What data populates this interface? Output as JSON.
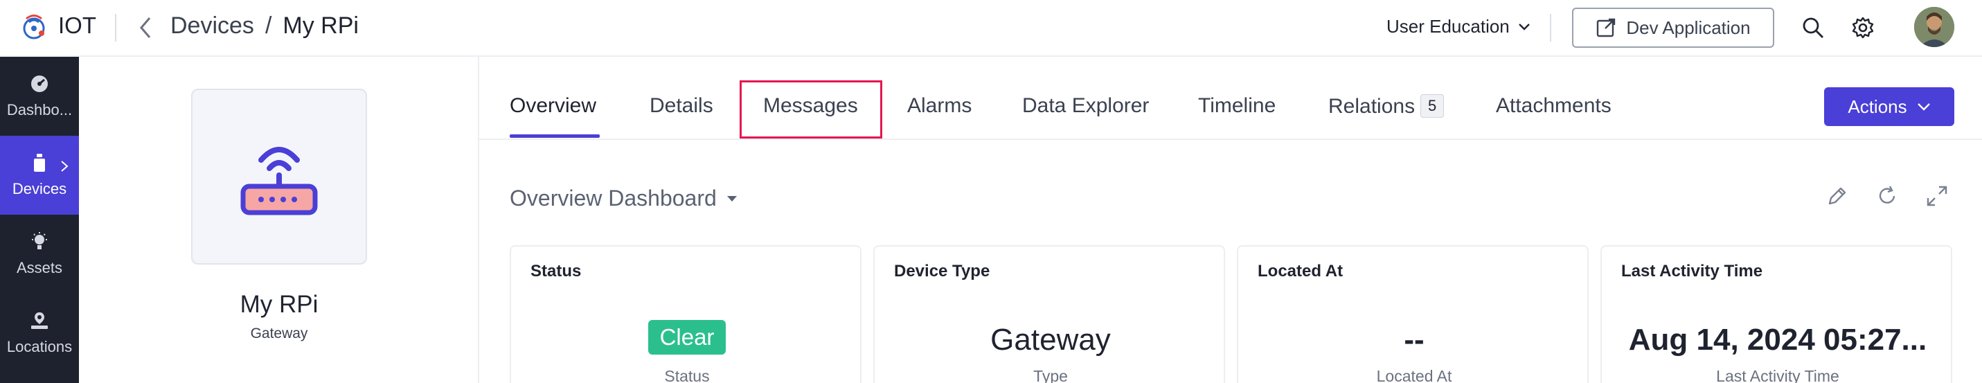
{
  "header": {
    "app_name": "IOT",
    "breadcrumb": {
      "parent": "Devices",
      "separator": "/",
      "current": "My RPi"
    },
    "org_selector": "User Education",
    "dev_app_button": "Dev Application",
    "icons": [
      "back-chevron-icon",
      "search-icon",
      "gear-icon",
      "external-link-icon",
      "chevron-down-icon"
    ]
  },
  "nav": {
    "items": [
      {
        "label": "Dashbo...",
        "icon": "dashboard-icon",
        "active": false
      },
      {
        "label": "Devices",
        "icon": "device-icon",
        "active": true
      },
      {
        "label": "Assets",
        "icon": "asset-icon",
        "active": false
      },
      {
        "label": "Locations",
        "icon": "location-icon",
        "active": false
      }
    ]
  },
  "device": {
    "name": "My RPi",
    "type": "Gateway",
    "icon": "router-icon"
  },
  "tabs": [
    {
      "label": "Overview",
      "active": true
    },
    {
      "label": "Details"
    },
    {
      "label": "Messages",
      "highlighted": true
    },
    {
      "label": "Alarms"
    },
    {
      "label": "Data Explorer"
    },
    {
      "label": "Timeline"
    },
    {
      "label": "Relations",
      "badge": "5"
    },
    {
      "label": "Attachments"
    }
  ],
  "actions_button": "Actions",
  "dashboard": {
    "title": "Overview Dashboard",
    "tools": [
      "edit-icon",
      "refresh-icon",
      "expand-icon"
    ],
    "cards": [
      {
        "label": "Status",
        "value": "Clear",
        "subtitle": "Status"
      },
      {
        "label": "Device Type",
        "value": "Gateway",
        "subtitle": "Type"
      },
      {
        "label": "Located At",
        "value": "--",
        "subtitle": "Located At"
      },
      {
        "label": "Last Activity Time",
        "value": "Aug 14, 2024 05:27...",
        "subtitle": "Last Activity Time"
      }
    ]
  },
  "colors": {
    "accent": "#4a3fd6",
    "nav_bg": "#1e222e",
    "status_clear": "#2bbf8e",
    "highlight_box": "#e4174f"
  }
}
